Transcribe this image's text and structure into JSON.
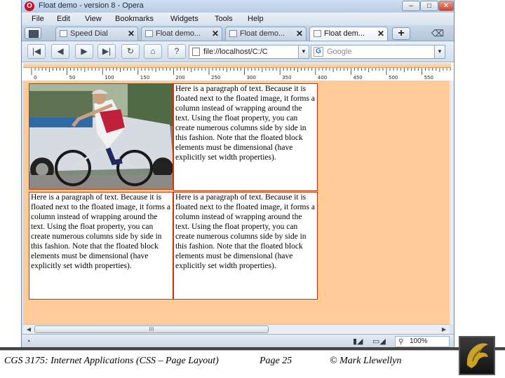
{
  "window": {
    "title": "Float demo - version 8 - Opera",
    "controls": {
      "minimize": "–",
      "maximize": "□",
      "close": "✕"
    }
  },
  "menubar": [
    "File",
    "Edit",
    "View",
    "Bookmarks",
    "Widgets",
    "Tools",
    "Help"
  ],
  "tabs": [
    {
      "label": "Speed Dial",
      "icon": "speed-dial-icon",
      "close": "✕",
      "active": false
    },
    {
      "label": "Float demo...",
      "icon": "page-icon",
      "close": "✕",
      "active": false
    },
    {
      "label": "Float demo...",
      "icon": "page-icon",
      "close": "✕",
      "active": false
    },
    {
      "label": "Float dem...",
      "icon": "page-icon",
      "close": "✕",
      "active": true
    }
  ],
  "new_tab": "+",
  "tab_dots": "...",
  "navbar": {
    "buttons": [
      {
        "name": "rewind-button",
        "icon": "rewind-icon",
        "glyph": "|◀"
      },
      {
        "name": "back-button",
        "icon": "back-arrow-icon",
        "glyph": "◀"
      },
      {
        "name": "forward-button",
        "icon": "forward-arrow-icon",
        "glyph": "▶"
      },
      {
        "name": "fast-forward-button",
        "icon": "fast-forward-icon",
        "glyph": "▶|"
      },
      {
        "name": "reload-button",
        "icon": "reload-icon",
        "glyph": "↻"
      },
      {
        "name": "home-button",
        "icon": "home-icon",
        "glyph": "⌂"
      },
      {
        "name": "wand-button",
        "icon": "wand-icon",
        "glyph": "?"
      }
    ],
    "address": "file://localhost/C:/C",
    "dropdown_glyph": "▼",
    "search_placeholder": "Google",
    "search_engine_letter": "G"
  },
  "ruler": {
    "labels": [
      "0",
      "50",
      "100",
      "150",
      "200",
      "250",
      "300",
      "350",
      "400",
      "450",
      "500",
      "550"
    ]
  },
  "content": {
    "paragraph": "Here is a paragraph of text. Because it is floated next to the floated image, it forms a column instead of wrapping around the text. Using the float property, you can create numerous columns side by side in this fashion. Note that the floated block elements must be dimensional (have explicitly set width properties).",
    "photo_alt": "cyclist-photo"
  },
  "statusbar": {
    "zoom": "100%",
    "scroll_grip": "III"
  },
  "footer": {
    "course": "CGS 3175: Internet Applications (CSS – Page Layout)",
    "page": "Page 25",
    "copyright": "© Mark Llewellyn"
  },
  "colors": {
    "page_bg": "#ffcc99",
    "column_border": "#cc3300",
    "ucf_gold": "#c9a227"
  }
}
